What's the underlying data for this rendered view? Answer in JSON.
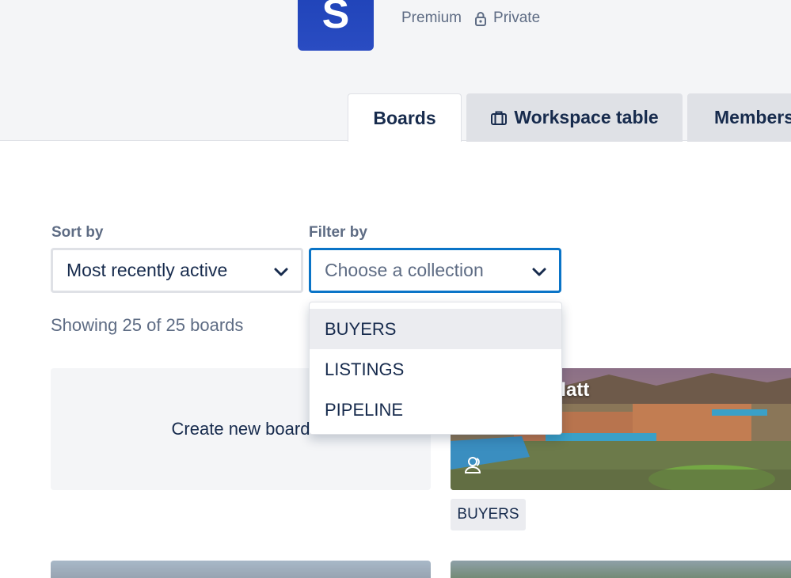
{
  "workspace": {
    "logo_letter": "S",
    "plan": "Premium",
    "visibility": "Private"
  },
  "tabs": [
    {
      "label": "Boards",
      "active": true
    },
    {
      "label": "Workspace table",
      "icon": "briefcase-icon"
    },
    {
      "label": "Members"
    }
  ],
  "sort": {
    "label": "Sort by",
    "value": "Most recently active"
  },
  "filter": {
    "label": "Filter by",
    "placeholder": "Choose a collection"
  },
  "filter_options": [
    "BUYERS",
    "LISTINGS",
    "PIPELINE"
  ],
  "highlighted_option": "BUYERS",
  "showing_text": "Showing 25 of 25 boards",
  "create_board_label": "Create new board",
  "boards": [
    {
      "title": "Kimberly Platt",
      "collection": "BUYERS"
    }
  ],
  "colors": {
    "accent_blue": "#0a74c7",
    "logo_blue": "#1f43b8",
    "text_dark": "#172b4d",
    "text_muted": "#5e6c84"
  }
}
